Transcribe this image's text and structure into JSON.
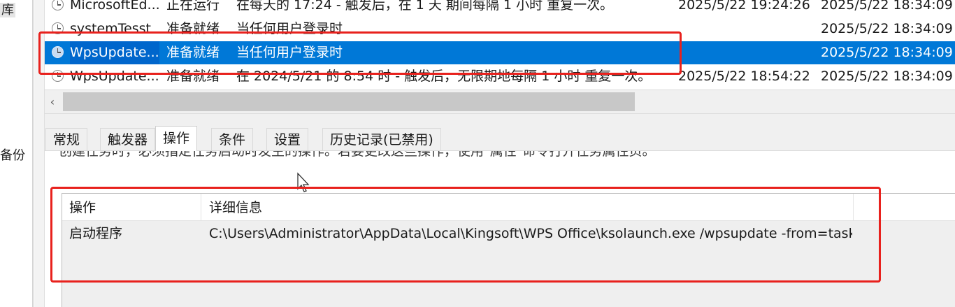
{
  "left_nav": {
    "fragment_top": "库",
    "fragment_backup": "备份"
  },
  "task_list": {
    "rows": [
      {
        "name": "MicrosoftEd...",
        "status": "正在运行",
        "trigger": "在每天的 17:24 - 触发后，在 1 天 期间每隔 1 小时 重复一次。",
        "next_run": "2025/5/22 19:24:26",
        "last_run": "2025/5/22 18:34:09",
        "selected": false
      },
      {
        "name": "systemTesst",
        "status": "准备就绪",
        "trigger": "当任何用户登录时",
        "next_run": "",
        "last_run": "2025/5/22 18:34:09",
        "selected": false
      },
      {
        "name": "WpsUpdate...",
        "status": "准备就绪",
        "trigger": "当任何用户登录时",
        "next_run": "",
        "last_run": "2025/5/22 18:34:09",
        "selected": true
      },
      {
        "name": "WpsUpdate...",
        "status": "准备就绪",
        "trigger": "在 2024/5/21 的 8:54 时 - 触发后，无限期地每隔 1 小时 重复一次。",
        "next_run": "2025/5/22 18:54:22",
        "last_run": "2025/5/22 18:34:09",
        "selected": false
      }
    ]
  },
  "scrollbar": {
    "left_arrow": "‹"
  },
  "tabs": [
    {
      "label": "常规",
      "active": false
    },
    {
      "label": "触发器",
      "active": false
    },
    {
      "label": "操作",
      "active": true
    },
    {
      "label": "条件",
      "active": false
    },
    {
      "label": "设置",
      "active": false
    },
    {
      "label": "历史记录(已禁用)",
      "active": false
    }
  ],
  "actions_panel": {
    "description_partial": "创建任务时，必须指定任务启动时发生的操作。若要更改这些操作，使用\"属性\"命令打开任务属性页。",
    "columns": [
      "操作",
      "详细信息"
    ],
    "rows": [
      {
        "action": "启动程序",
        "details": "C:\\Users\\Administrator\\AppData\\Local\\Kingsoft\\WPS Office\\ksolaunch.exe /wpsupdate -from=task ..."
      }
    ]
  },
  "colors": {
    "selection": "#0078d7",
    "annotation_red": "#e8211d"
  }
}
